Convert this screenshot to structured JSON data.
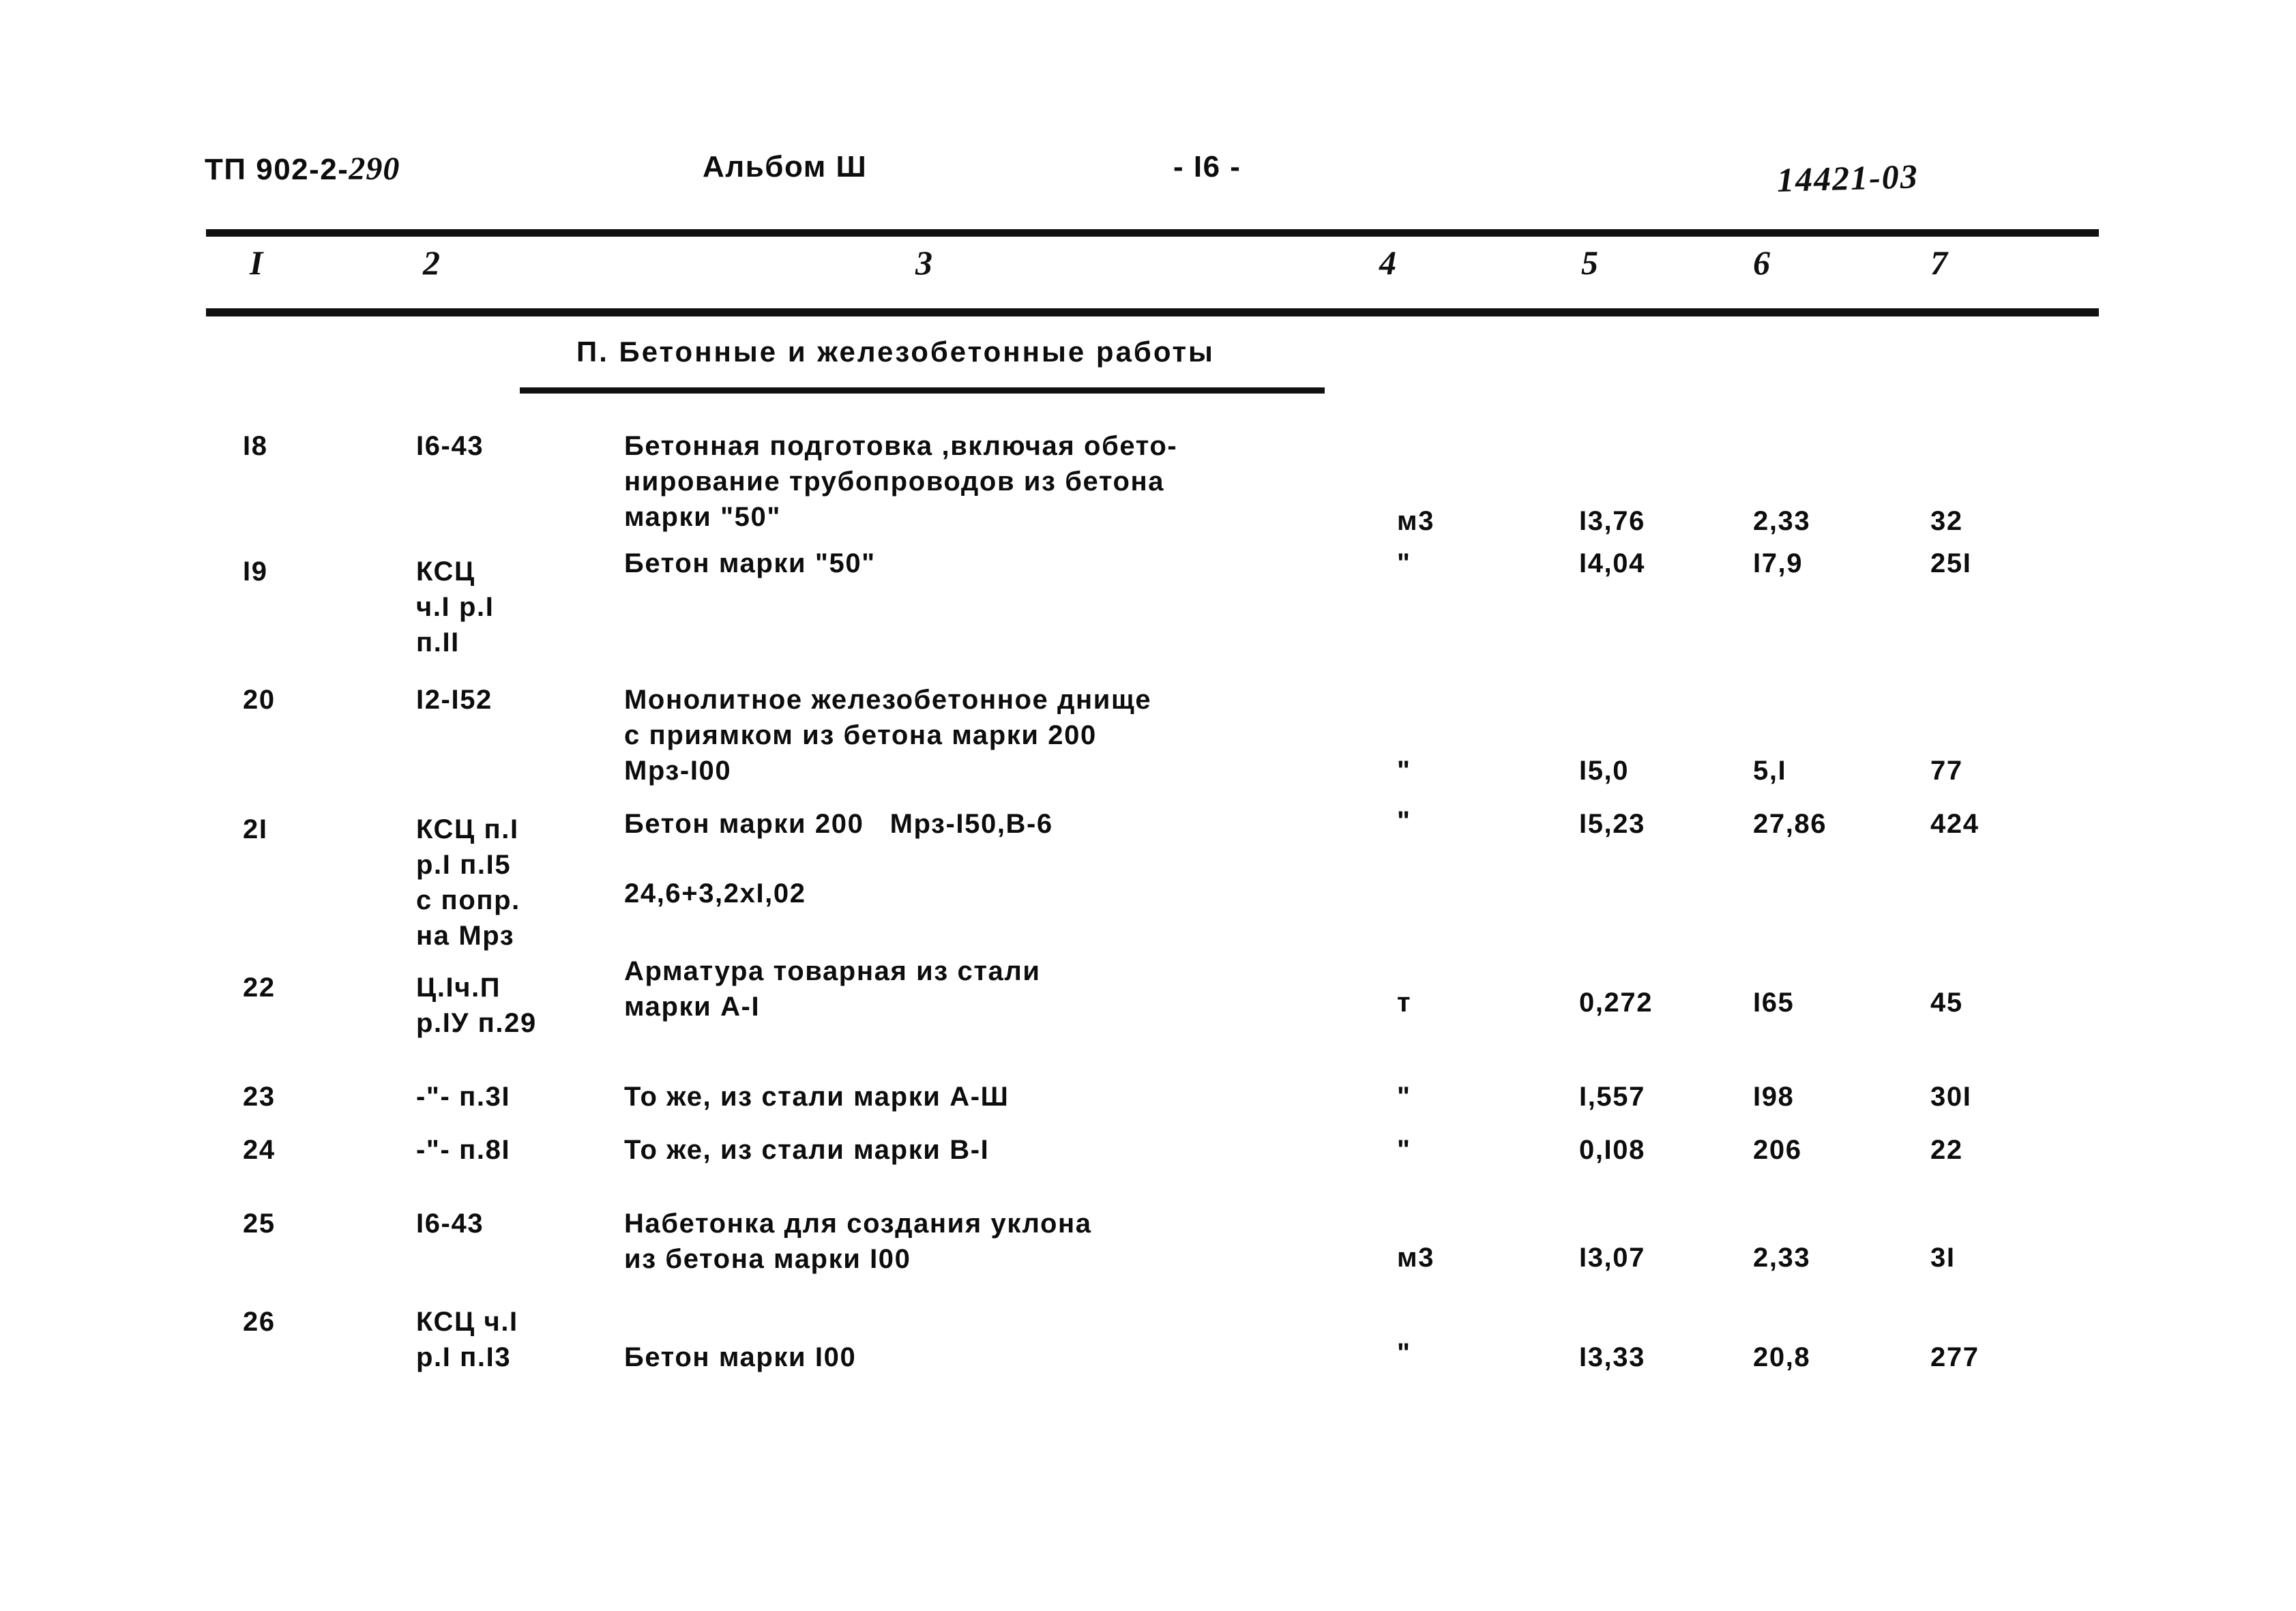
{
  "header": {
    "doc_prefix": "ТП 902-2-",
    "doc_number_hand": "290",
    "album": "Альбом Ш",
    "page": "- I6 -",
    "archive_code": "14421-03"
  },
  "column_numbers": [
    "I",
    "2",
    "3",
    "4",
    "5",
    "6",
    "7"
  ],
  "section": {
    "title": "П. Бетонные и железобетонные работы"
  },
  "rows": [
    {
      "num": "I8",
      "code": "I6-43",
      "description": "Бетонная подготовка ,включая обето-\nнирование трубопроводов из бетона\nмарки \"50\"",
      "unit": "м3",
      "col5": "I3,76",
      "col6": "2,33",
      "col7": "32"
    },
    {
      "num": "I9",
      "code": "КСЦ\nч.I р.I\nп.II",
      "description": "Бетон марки \"50\"",
      "unit": "\"",
      "col5": "I4,04",
      "col6": "I7,9",
      "col7": "25I"
    },
    {
      "num": "20",
      "code": "I2-I52",
      "description": "Монолитное железобетонное днище\nс приямком из бетона марки 200\nМрз-I00",
      "unit": "\"",
      "col5": "I5,0",
      "col6": "5,I",
      "col7": "77"
    },
    {
      "num": "2I",
      "code": "КСЦ п.I\nр.I п.I5\nс попр.\nна Мрз",
      "description": "Бетон марки 200   Мрз-I50,В-6",
      "description_extra": "24,6+3,2xI,02",
      "unit": "\"",
      "col5": "I5,23",
      "col6": "27,86",
      "col7": "424"
    },
    {
      "num": "22",
      "code": "Ц.Iч.П\nр.IУ п.29",
      "description": "Арматура товарная из стали\nмарки А-I",
      "unit": "т",
      "col5": "0,272",
      "col6": "I65",
      "col7": "45"
    },
    {
      "num": "23",
      "code": "-\"- п.3I",
      "description": "То же, из стали марки А-Ш",
      "unit": "\"",
      "col5": "I,557",
      "col6": "I98",
      "col7": "30I"
    },
    {
      "num": "24",
      "code": "-\"- п.8I",
      "description": "То же, из стали марки В-I",
      "unit": "\"",
      "col5": "0,I08",
      "col6": "206",
      "col7": "22"
    },
    {
      "num": "25",
      "code": "I6-43",
      "description": "Набетонка для создания уклона\nиз бетона марки I00",
      "unit": "м3",
      "col5": "I3,07",
      "col6": "2,33",
      "col7": "3I"
    },
    {
      "num": "26",
      "code": "КСЦ ч.I\nр.I п.I3",
      "description": "Бетон марки I00",
      "unit": "\"",
      "col5": "I3,33",
      "col6": "20,8",
      "col7": "277"
    }
  ]
}
